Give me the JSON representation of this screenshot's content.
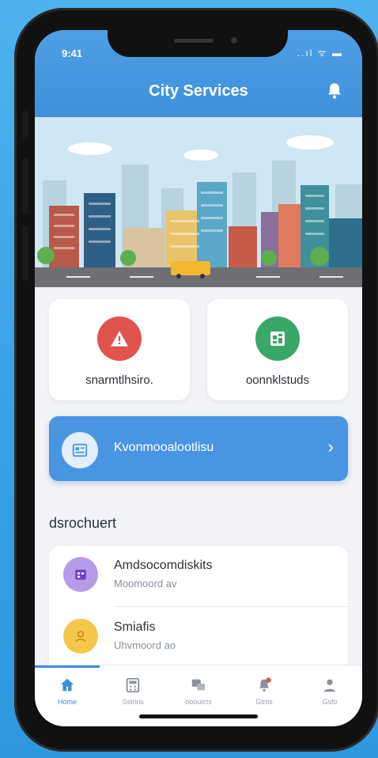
{
  "status_bar": {
    "time": "9:41",
    "icons": "..ıl ᯤ ▬"
  },
  "header": {
    "title": "City Services",
    "bell_icon": "bell-icon"
  },
  "quick_actions": [
    {
      "label": "snarmtlhsiro.",
      "icon": "alert-triangle-icon",
      "color": "#e0544f"
    },
    {
      "label": "oonnklstuds",
      "icon": "map-icon",
      "color": "#3aa768"
    }
  ],
  "feature_banner": {
    "label": "Kvonmooalootlisu",
    "icon": "document-icon",
    "chevron": "›"
  },
  "section": {
    "title": "dsrochuert"
  },
  "list_items": [
    {
      "title": "Amdsocomdiskits",
      "subtitle": "Moomoord av",
      "icon": "calendar-icon",
      "color": "#b79ae8"
    },
    {
      "title": "Smiafis",
      "subtitle": "Uhvmoord ao",
      "icon": "user-icon",
      "color": "#f3c84a"
    }
  ],
  "tabs": [
    {
      "label": "Home",
      "icon": "home-icon",
      "active": true
    },
    {
      "label": "Sstriris",
      "icon": "calculator-icon",
      "active": false
    },
    {
      "label": "ooouicts",
      "icon": "chat-icon",
      "active": false
    },
    {
      "label": "Gtrtis",
      "icon": "notification-icon",
      "active": false
    },
    {
      "label": "Gsfo",
      "icon": "profile-icon",
      "active": false
    }
  ],
  "colors": {
    "primary": "#4a95e2",
    "background": "#f2f4f8",
    "accent_red": "#e0544f",
    "accent_green": "#3aa768"
  }
}
